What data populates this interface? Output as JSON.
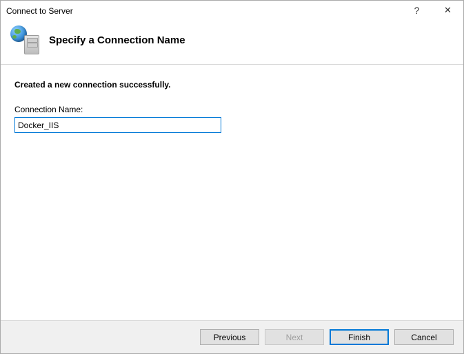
{
  "titlebar": {
    "title": "Connect to Server",
    "help": "?",
    "close": "✕"
  },
  "header": {
    "heading": "Specify a Connection Name"
  },
  "content": {
    "status": "Created a new connection successfully.",
    "label": "Connection Name:",
    "value": "Docker_IIS"
  },
  "footer": {
    "previous": "Previous",
    "next": "Next",
    "finish": "Finish",
    "cancel": "Cancel"
  }
}
